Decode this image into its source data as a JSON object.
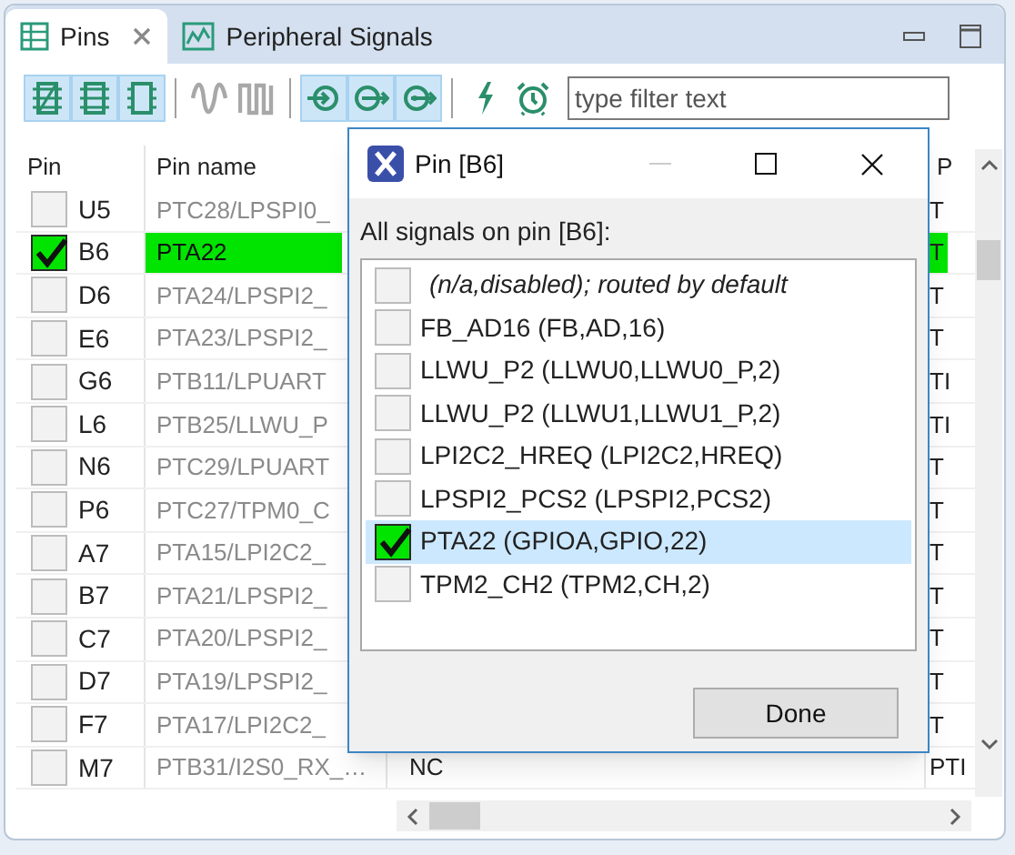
{
  "tabs": [
    {
      "label": "Pins",
      "selected": true,
      "closable": true
    },
    {
      "label": "Peripheral Signals",
      "selected": false,
      "closable": false
    }
  ],
  "toolbar": [
    {
      "selected": true,
      "disabled": false
    },
    {
      "selected": true,
      "disabled": false
    },
    {
      "selected": true,
      "disabled": false
    },
    {
      "selected": false,
      "disabled": true
    },
    {
      "selected": false,
      "disabled": true
    },
    {
      "selected": true,
      "disabled": false
    },
    {
      "selected": true,
      "disabled": false
    },
    {
      "selected": true,
      "disabled": false
    },
    {
      "selected": false,
      "disabled": false
    },
    {
      "selected": false,
      "disabled": false
    }
  ],
  "filter": {
    "placeholder": "type filter text"
  },
  "table": {
    "columns": [
      "Pin",
      "Pin name",
      "",
      "P"
    ],
    "rows": [
      {
        "pin": "U5",
        "name": "PTC28/LPSPI0_",
        "checked": false,
        "column_4": "T"
      },
      {
        "pin": "B6",
        "name": "PTA22",
        "checked": true,
        "column_4": "T"
      },
      {
        "pin": "D6",
        "name": "PTA24/LPSPI2_",
        "checked": false,
        "column_4": "T"
      },
      {
        "pin": "E6",
        "name": "PTA23/LPSPI2_",
        "checked": false,
        "column_4": "T"
      },
      {
        "pin": "G6",
        "name": "PTB11/LPUART",
        "checked": false,
        "column_4": "TI"
      },
      {
        "pin": "L6",
        "name": "PTB25/LLWU_P",
        "checked": false,
        "column_4": "TI"
      },
      {
        "pin": "N6",
        "name": "PTC29/LPUART",
        "checked": false,
        "column_4": "T"
      },
      {
        "pin": "P6",
        "name": "PTC27/TPM0_C",
        "checked": false,
        "column_4": "T"
      },
      {
        "pin": "A7",
        "name": "PTA15/LPI2C2_",
        "checked": false,
        "column_4": "T"
      },
      {
        "pin": "B7",
        "name": "PTA21/LPSPI2_",
        "checked": false,
        "column_4": "T"
      },
      {
        "pin": "C7",
        "name": "PTA20/LPSPI2_",
        "checked": false,
        "column_4": "T"
      },
      {
        "pin": "D7",
        "name": "PTA19/LPSPI2_",
        "checked": false,
        "column_4": "T"
      },
      {
        "pin": "F7",
        "name": "PTA17/LPI2C2_",
        "checked": false,
        "column_4": "T"
      },
      {
        "pin": "M7",
        "name": "PTB31/I2S0_RX_…",
        "checked": false,
        "column_3": "NC",
        "column_4": "PTI"
      }
    ]
  },
  "dialog": {
    "title": "Pin [B6]",
    "heading": "All signals on pin [B6]:",
    "signals": [
      {
        "label": "(n/a,disabled); routed by default",
        "kind": "default",
        "checked": false,
        "selected": false
      },
      {
        "label": "FB_AD16 (FB,AD,16)",
        "kind": "signal",
        "checked": false,
        "selected": false
      },
      {
        "label": "LLWU_P2 (LLWU0,LLWU0_P,2)",
        "kind": "signal",
        "checked": false,
        "selected": false
      },
      {
        "label": "LLWU_P2 (LLWU1,LLWU1_P,2)",
        "kind": "signal",
        "checked": false,
        "selected": false
      },
      {
        "label": "LPI2C2_HREQ (LPI2C2,HREQ)",
        "kind": "signal",
        "checked": false,
        "selected": false
      },
      {
        "label": "LPSPI2_PCS2 (LPSPI2,PCS2)",
        "kind": "signal",
        "checked": false,
        "selected": false
      },
      {
        "label": "PTA22 (GPIOA,GPIO,22)",
        "kind": "signal",
        "checked": true,
        "selected": true
      },
      {
        "label": "TPM2_CH2 (TPM2,CH,2)",
        "kind": "signal",
        "checked": false,
        "selected": false
      }
    ],
    "button": "Done"
  }
}
